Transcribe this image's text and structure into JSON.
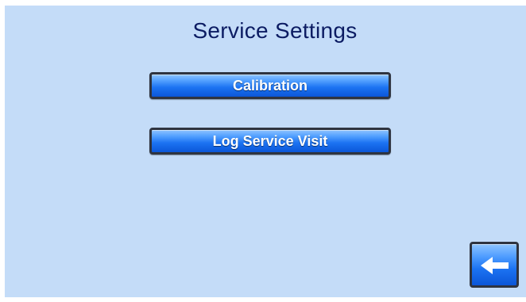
{
  "screen": {
    "title": "Service Settings"
  },
  "buttons": {
    "calibration_label": "Calibration",
    "log_service_visit_label": "Log Service Visit"
  },
  "navigation": {
    "back_icon": "left-arrow-icon"
  },
  "colors": {
    "background": "#c4dcf8",
    "title_text": "#0c1c63",
    "button_top": "#8fc4ff",
    "button_bottom": "#0b56d8",
    "button_text": "#ffffff"
  }
}
